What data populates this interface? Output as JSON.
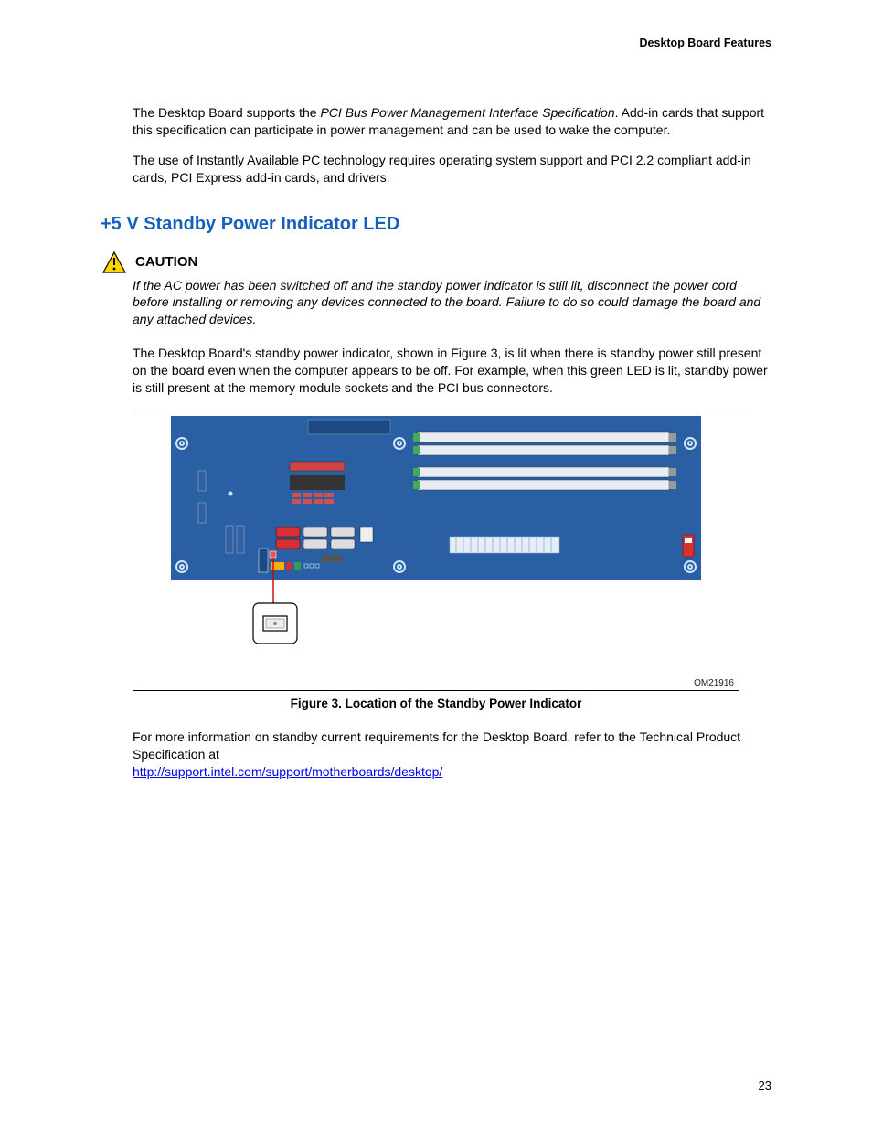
{
  "header": {
    "section_title": "Desktop Board Features"
  },
  "paragraphs": {
    "p1_a": "The Desktop Board supports the ",
    "p1_b": "PCI Bus Power Management Interface Specification",
    "p1_c": ". Add-in cards that support this specification can participate in power management and can be used to wake the computer.",
    "p2": "The use of Instantly Available PC technology requires operating system support and PCI 2.2 compliant add-in cards, PCI Express add-in cards, and drivers."
  },
  "heading": "+5 V Standby Power Indicator LED",
  "caution": {
    "label": "CAUTION",
    "text": "If the AC power has been switched off and the standby power indicator is still lit, disconnect the power cord before installing or removing any devices connected to the board.  Failure to do so could damage the board and any attached devices."
  },
  "body": {
    "p3": "The Desktop Board's standby power indicator, shown in Figure 3, is lit when there is standby power still present on the board even when the computer appears to be off. For example, when this green LED is lit, standby power is still present at the memory module sockets and the PCI bus connectors."
  },
  "figure": {
    "ref": "OM21916",
    "caption": "Figure 3.  Location of the Standby Power Indicator"
  },
  "closing": {
    "text_a": "For more information on standby current requirements for the Desktop Board, refer to the Technical Product Specification at",
    "link": "http://support.intel.com/support/motherboards/desktop/"
  },
  "page_number": "23"
}
